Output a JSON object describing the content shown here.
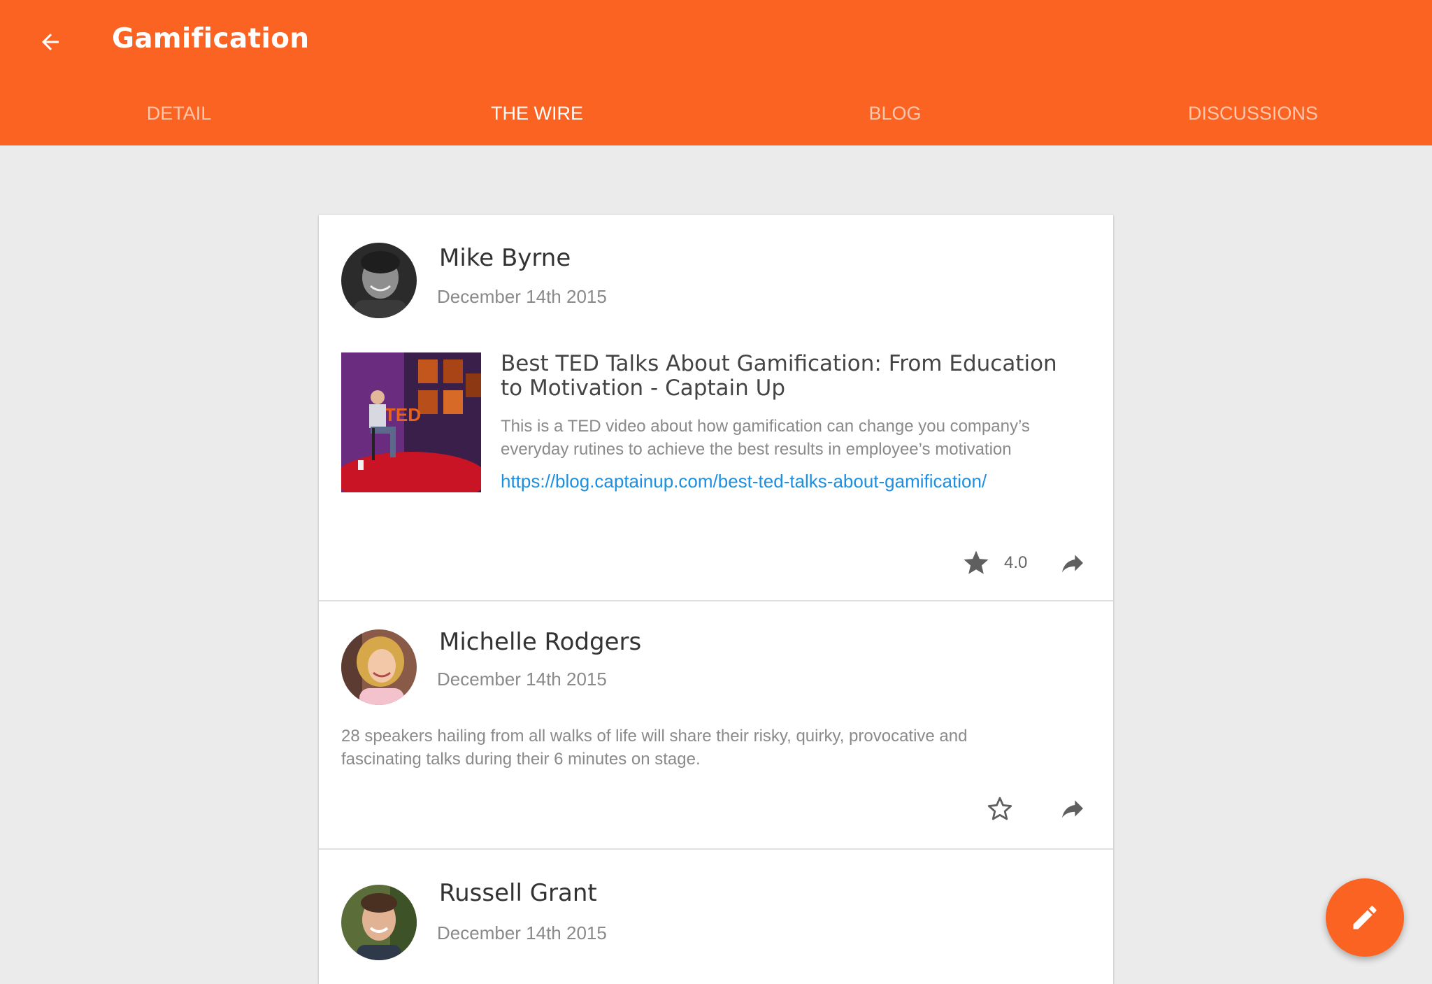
{
  "app": {
    "title": "Gamification",
    "accent": "#fb6323"
  },
  "tabs": [
    {
      "label": "DETAIL",
      "active": false
    },
    {
      "label": "THE WIRE",
      "active": true
    },
    {
      "label": "BLOG",
      "active": false
    },
    {
      "label": "DISCUSSIONS",
      "active": false
    }
  ],
  "posts": [
    {
      "author": "Mike Byrne",
      "date": "December 14th 2015",
      "link": {
        "title": "Best TED Talks About Gamification: From Education to Motivation - Captain Up",
        "description": "This is a TED video about how gamification can change you company’s everyday rutines to achieve the best results in employee’s motivation",
        "url": "https://blog.captainup.com/best-ted-talks-about-gamification/",
        "thumbnail_text": "TED"
      },
      "rating": "4.0",
      "starred": true
    },
    {
      "author": "Michelle Rodgers",
      "date": "December 14th 2015",
      "text": "28 speakers hailing from all walks of life will share their risky, quirky, provocative and fascinating talks during their 6 minutes on stage.",
      "starred": false
    },
    {
      "author": "Russell Grant",
      "date": "December 14th 2015"
    }
  ],
  "icons": {
    "back": "arrow-back-icon",
    "star_filled": "star-filled-icon",
    "star_outline": "star-outline-icon",
    "share": "share-icon",
    "edit": "pencil-icon"
  }
}
